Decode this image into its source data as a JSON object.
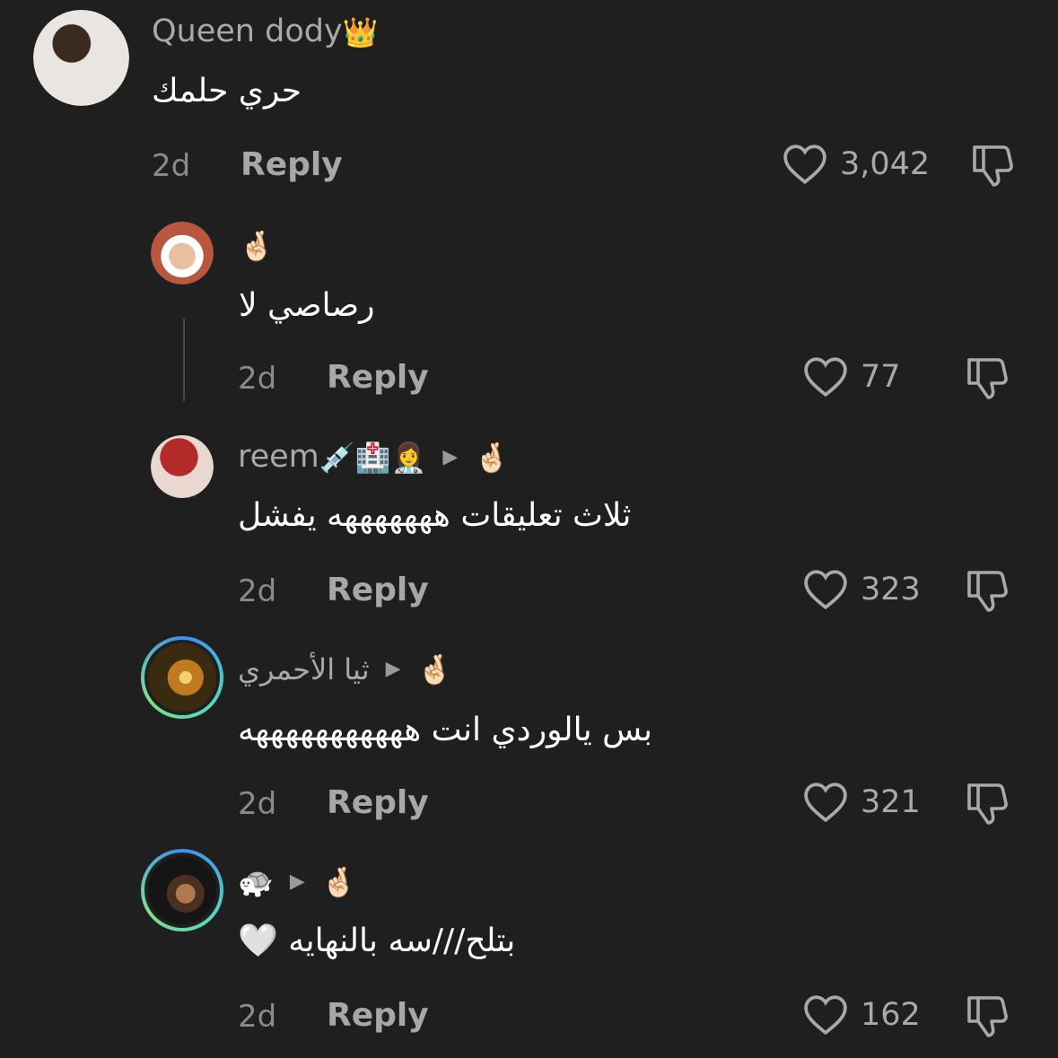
{
  "comments": [
    {
      "username": "Queen dody",
      "username_emoji": "👑",
      "text": "حري حلمك",
      "time": "2d",
      "reply_label": "Reply",
      "likes": "3,042",
      "avatar_colors": [
        "#e9e6e1",
        "#5a4030"
      ]
    },
    {
      "username": "",
      "username_emoji": "🤞🏻",
      "text": "رصاصي لا",
      "time": "2d",
      "reply_label": "Reply",
      "likes": "77",
      "avatar_colors": [
        "#cfcfcf",
        "#b8563f"
      ]
    },
    {
      "username": "reem",
      "username_emoji": "💉🏥👩‍⚕️",
      "reply_to_emoji": "🤞🏻",
      "text": "ثلاث تعليقات هههههههه يفشل",
      "time": "2d",
      "reply_label": "Reply",
      "likes": "323",
      "avatar_colors": [
        "#b22a2a",
        "#e8d8d0"
      ]
    },
    {
      "username": "ثيا الأحمري",
      "reply_to_emoji": "🤞🏻",
      "text": "بس يالوردي انت هههههههههههه",
      "time": "2d",
      "reply_label": "Reply",
      "likes": "321",
      "avatar_colors": [
        "#f0c060",
        "#3a2a10"
      ]
    },
    {
      "username": "🐢",
      "reply_to_emoji": "🤞🏻",
      "text": "بتلح///سه بالنهايه 🤍",
      "time": "2d",
      "reply_label": "Reply",
      "likes": "162",
      "avatar_colors": [
        "#222222",
        "#b07850"
      ]
    }
  ],
  "icons": {
    "like": "heart-outline-icon",
    "dislike": "thumbs-down-outline-icon",
    "reply_arrow": "play-triangle-icon"
  },
  "colors": {
    "background": "#1f1f1f",
    "secondary_text": "#a9a9a9",
    "story_ring": [
      "#3f8ef0",
      "#7ee08a"
    ]
  }
}
